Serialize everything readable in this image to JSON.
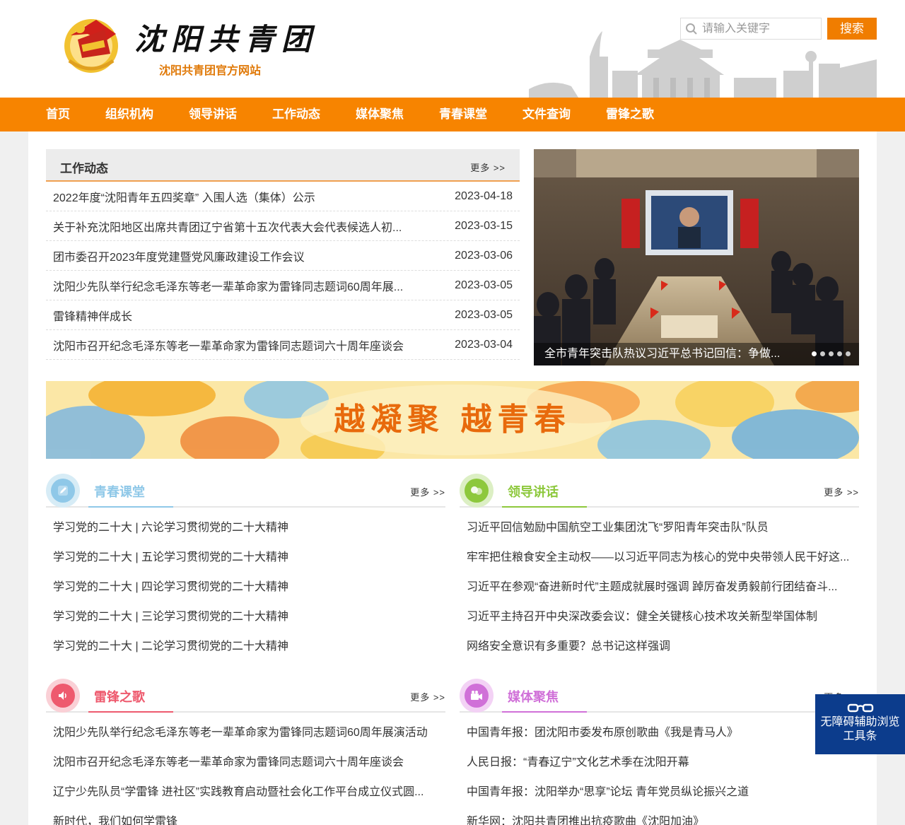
{
  "site": {
    "title": "沈阳共青团",
    "subtitle": "沈阳共青团官方网站"
  },
  "search": {
    "placeholder": "请输入关键字",
    "button": "搜索"
  },
  "nav": [
    "首页",
    "组织机构",
    "领导讲话",
    "工作动态",
    "媒体聚焦",
    "青春课堂",
    "文件查询",
    "雷锋之歌"
  ],
  "more_label": "更多 >>",
  "work_news": {
    "title": "工作动态",
    "items": [
      {
        "title": "2022年度“沈阳青年五四奖章” 入围人选（集体）公示",
        "date": "2023-04-18"
      },
      {
        "title": "关于补充沈阳地区出席共青团辽宁省第十五次代表大会代表候选人初...",
        "date": "2023-03-15"
      },
      {
        "title": "团市委召开2023年度党建暨党风廉政建设工作会议",
        "date": "2023-03-06"
      },
      {
        "title": "沈阳少先队举行纪念毛泽东等老一辈革命家为雷锋同志题词60周年展...",
        "date": "2023-03-05"
      },
      {
        "title": "雷锋精神伴成长",
        "date": "2023-03-05"
      },
      {
        "title": "沈阳市召开纪念毛泽东等老一辈革命家为雷锋同志题词六十周年座谈会",
        "date": "2023-03-04"
      }
    ]
  },
  "slideshow": {
    "caption": "全市青年突击队热议习近平总书记回信：争做...",
    "dots": 5,
    "active": 1
  },
  "banner": {
    "text": "越凝聚 越青春"
  },
  "panels": {
    "youth_class": {
      "title": "青春课堂",
      "color": "#8fc8e8",
      "icon": "pencil-icon",
      "items": [
        "学习党的二十大 | 六论学习贯彻党的二十大精神",
        "学习党的二十大 | 五论学习贯彻党的二十大精神",
        "学习党的二十大 | 四论学习贯彻党的二十大精神",
        "学习党的二十大 | 三论学习贯彻党的二十大精神",
        "学习党的二十大 | 二论学习贯彻党的二十大精神"
      ]
    },
    "leader_speech": {
      "title": "领导讲话",
      "color": "#8dc83c",
      "icon": "chat-icon",
      "items": [
        "习近平回信勉励中国航空工业集团沈飞“罗阳青年突击队”队员",
        "牢牢把住粮食安全主动权——以习近平同志为核心的党中央带领人民干好这...",
        "习近平在参观“奋进新时代”主题成就展时强调 踔厉奋发勇毅前行团结奋斗...",
        "习近平主持召开中央深改委会议：健全关键核心技术攻关新型举国体制",
        "网络安全意识有多重要？总书记这样强调"
      ]
    },
    "leifeng_song": {
      "title": "雷锋之歌",
      "color": "#ee5a6e",
      "icon": "speaker-icon",
      "items": [
        "沈阳少先队举行纪念毛泽东等老一辈革命家为雷锋同志题词60周年展演活动",
        "沈阳市召开纪念毛泽东等老一辈革命家为雷锋同志题词六十周年座谈会",
        "辽宁少先队员“学雷锋 进社区”实践教育启动暨社会化工作平台成立仪式圆...",
        "新时代，我们如何学雷锋"
      ]
    },
    "media_focus": {
      "title": "媒体聚焦",
      "color": "#d070d8",
      "icon": "camera-icon",
      "items": [
        "中国青年报：团沈阳市委发布原创歌曲《我是青马人》",
        "人民日报：“青春辽宁”文化艺术季在沈阳开幕",
        "中国青年报：沈阳举办“思享”论坛 青年党员纵论振兴之道",
        "新华网：沈阳共青团推出抗疫歌曲《沈阳加油》"
      ]
    }
  },
  "accessibility": {
    "line1": "无障碍辅助浏览",
    "line2": "工具条",
    "icon": "glasses-icon"
  },
  "colors": {
    "nav_orange": "#f78400",
    "accent_orange": "#f07d00",
    "access_blue": "#0c3c8c"
  }
}
